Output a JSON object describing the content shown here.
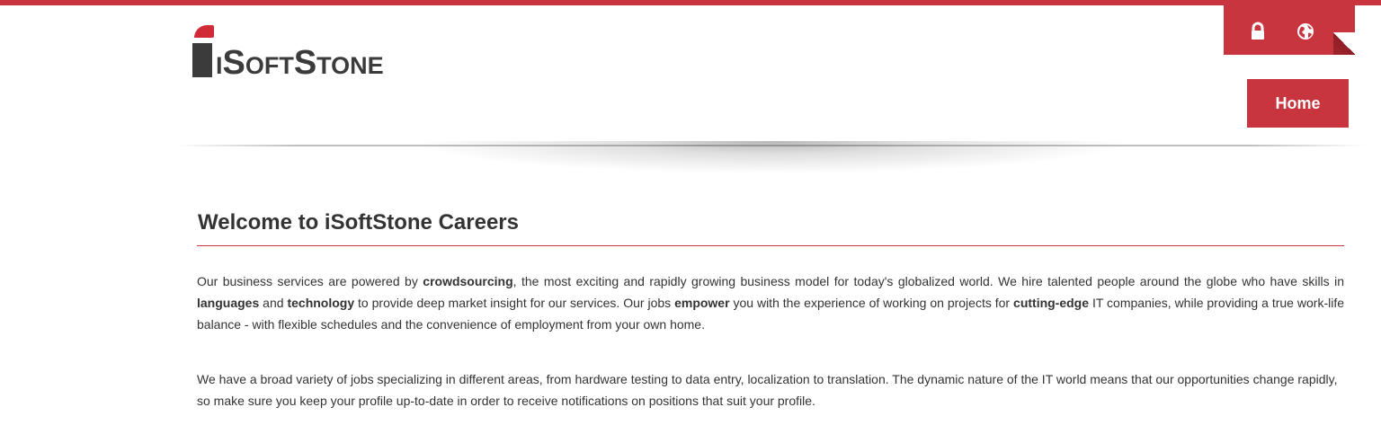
{
  "header": {
    "logo_text": "iSoftStone",
    "home_label": "Home",
    "icons": [
      "lock-icon",
      "globe-icon"
    ]
  },
  "colors": {
    "accent": "#c9353f",
    "text": "#333333",
    "logo_gray": "#3b3b3b"
  },
  "main": {
    "title": "Welcome to iSoftStone Careers",
    "p1": {
      "t1": "Our business services are powered by ",
      "b1": "crowdsourcing",
      "t2": ", the most exciting and rapidly growing business model for today's globalized world. We hire talented people around the globe who have skills in ",
      "b2": "languages",
      "t3": " and ",
      "b3": "technology",
      "t4": " to provide deep market insight for our services. Our jobs ",
      "b4": "empower",
      "t5": " you with the experience of working on projects for ",
      "b5": "cutting-edge",
      "t6": " IT companies, while providing a true work-life balance - with flexible schedules and the convenience of employment from your own home."
    },
    "p2": "We have a broad variety of jobs specializing in different areas, from hardware testing to data entry, localization to translation. The dynamic nature of the IT world means that our opportunities change rapidly, so make sure you keep your profile up-to-date in order to receive notifications on positions that suit your profile."
  }
}
